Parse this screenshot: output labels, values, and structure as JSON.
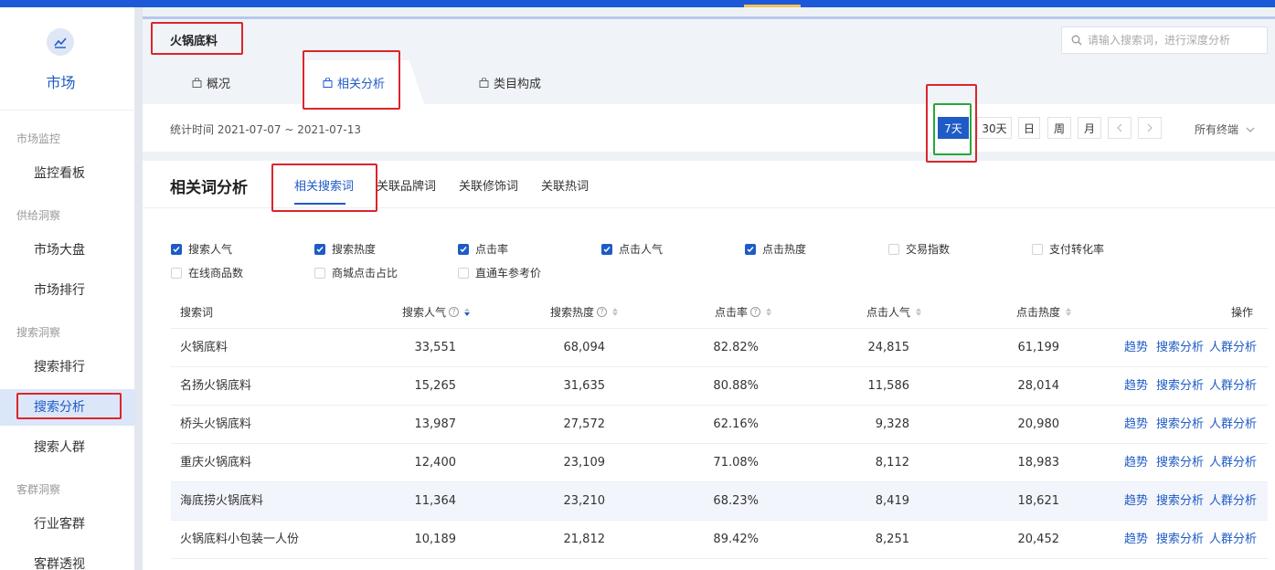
{
  "sidebar": {
    "title": "市场",
    "groups": [
      {
        "label": "市场监控",
        "items": [
          "监控看板"
        ]
      },
      {
        "label": "供给洞察",
        "items": [
          "市场大盘",
          "市场排行"
        ]
      },
      {
        "label": "搜索洞察",
        "items": [
          "搜索排行",
          "搜索分析",
          "搜索人群"
        ]
      },
      {
        "label": "客群洞察",
        "items": [
          "行业客群",
          "客群透视"
        ]
      }
    ],
    "active_item": "搜索分析"
  },
  "header": {
    "keyword": "火锅底料",
    "search_placeholder": "请输入搜索词，进行深度分析",
    "tabs": [
      "概况",
      "相关分析",
      "类目构成"
    ],
    "active_tab": "相关分析",
    "stat_time": "统计时间 2021-07-07 ~ 2021-07-13",
    "ranges": [
      "7天",
      "30天",
      "日",
      "周",
      "月"
    ],
    "active_range": "7天",
    "terminal": "所有终端"
  },
  "panel": {
    "title": "相关词分析",
    "subtabs": [
      "相关搜索词",
      "关联品牌词",
      "关联修饰词",
      "关联热词"
    ],
    "active_subtab": "相关搜索词",
    "metrics": [
      {
        "label": "搜索人气",
        "checked": true
      },
      {
        "label": "搜索热度",
        "checked": true
      },
      {
        "label": "点击率",
        "checked": true
      },
      {
        "label": "点击人气",
        "checked": true
      },
      {
        "label": "点击热度",
        "checked": true
      },
      {
        "label": "交易指数",
        "checked": false
      },
      {
        "label": "支付转化率",
        "checked": false
      },
      {
        "label": "在线商品数",
        "checked": false
      },
      {
        "label": "商城点击占比",
        "checked": false
      },
      {
        "label": "直通车参考价",
        "checked": false
      }
    ]
  },
  "table": {
    "columns": [
      "搜索词",
      "搜索人气",
      "搜索热度",
      "点击率",
      "点击人气",
      "点击热度",
      "操作"
    ],
    "actions": [
      "趋势",
      "搜索分析",
      "人群分析"
    ],
    "rows": [
      [
        "火锅底料",
        "33,551",
        "68,094",
        "82.82%",
        "24,815",
        "61,199"
      ],
      [
        "名扬火锅底料",
        "15,265",
        "31,635",
        "80.88%",
        "11,586",
        "28,014"
      ],
      [
        "桥头火锅底料",
        "13,987",
        "27,572",
        "62.16%",
        "9,328",
        "20,980"
      ],
      [
        "重庆火锅底料",
        "12,400",
        "23,109",
        "71.08%",
        "8,112",
        "18,983"
      ],
      [
        "海底捞火锅底料",
        "11,364",
        "23,210",
        "68.23%",
        "8,419",
        "18,621"
      ],
      [
        "火锅底料小包装一人份",
        "10,189",
        "21,812",
        "89.42%",
        "8,251",
        "20,452"
      ]
    ]
  },
  "colors": {
    "brand": "#1e5bc6",
    "annotation_red": "#d9262c",
    "annotation_green": "#27a83a"
  }
}
